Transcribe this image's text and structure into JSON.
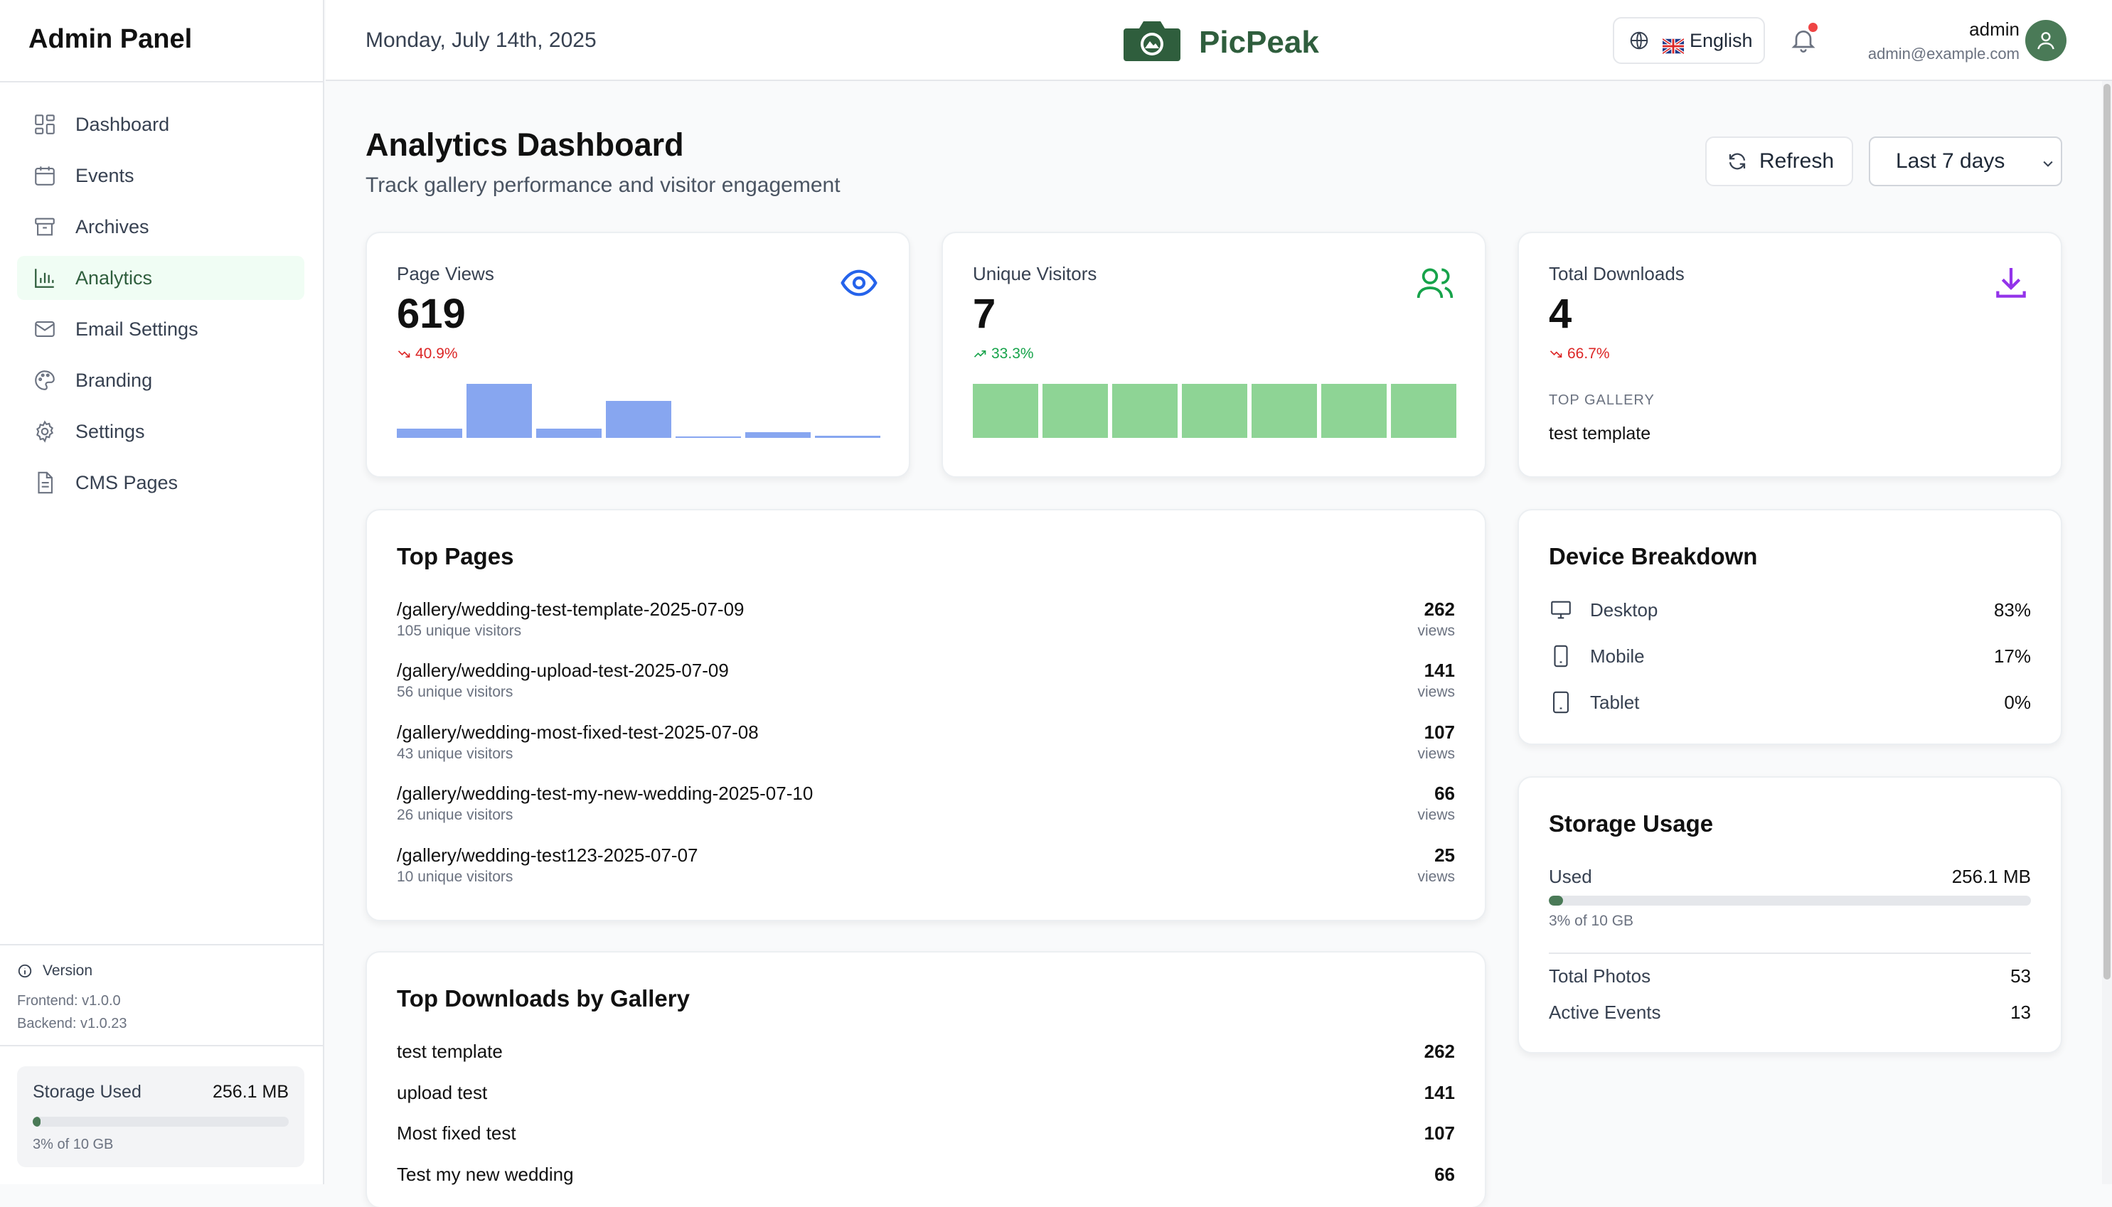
{
  "sidebar": {
    "title": "Admin Panel",
    "items": [
      {
        "label": "Dashboard",
        "icon": "grid-icon"
      },
      {
        "label": "Events",
        "icon": "calendar-icon"
      },
      {
        "label": "Archives",
        "icon": "archive-icon"
      },
      {
        "label": "Analytics",
        "icon": "bar-chart-icon",
        "active": true
      },
      {
        "label": "Email Settings",
        "icon": "mail-icon"
      },
      {
        "label": "Branding",
        "icon": "palette-icon"
      },
      {
        "label": "Settings",
        "icon": "gear-icon"
      },
      {
        "label": "CMS Pages",
        "icon": "document-icon"
      }
    ],
    "version": {
      "label": "Version",
      "frontend": "Frontend: v1.0.0",
      "backend": "Backend: v1.0.23"
    },
    "storage": {
      "label": "Storage Used",
      "value": "256.1 MB",
      "percent": 3,
      "sub": "3% of 10 GB"
    }
  },
  "header": {
    "date": "Monday, July 14th, 2025",
    "brand": "PicPeak",
    "language": "English",
    "user_name": "admin",
    "user_email": "admin@example.com",
    "has_notification": true
  },
  "page": {
    "title": "Analytics Dashboard",
    "subtitle": "Track gallery performance and visitor engagement",
    "refresh_label": "Refresh",
    "range_label": "Last 7 days"
  },
  "stats": {
    "page_views": {
      "label": "Page Views",
      "value": "619",
      "trend": "40.9%",
      "trend_dir": "down",
      "color": "#2563eb",
      "spark_color": "#87a6f0",
      "spark": [
        0.17,
        1.0,
        0.17,
        0.68,
        0.02,
        0.1,
        0.04
      ]
    },
    "unique_visitors": {
      "label": "Unique Visitors",
      "value": "7",
      "trend": "33.3%",
      "trend_dir": "up",
      "color": "#16a34a",
      "spark_color": "#8ed495",
      "spark": [
        1,
        1,
        1,
        1,
        1,
        1,
        1
      ]
    },
    "total_downloads": {
      "label": "Total Downloads",
      "value": "4",
      "trend": "66.7%",
      "trend_dir": "down",
      "color": "#9333ea",
      "top_gallery_label": "TOP GALLERY",
      "top_gallery": "test template"
    }
  },
  "top_pages": {
    "title": "Top Pages",
    "views_label": "views",
    "rows": [
      {
        "path": "/gallery/wedding-test-template-2025-07-09",
        "visitors": "105 unique visitors",
        "views": "262"
      },
      {
        "path": "/gallery/wedding-upload-test-2025-07-09",
        "visitors": "56 unique visitors",
        "views": "141"
      },
      {
        "path": "/gallery/wedding-most-fixed-test-2025-07-08",
        "visitors": "43 unique visitors",
        "views": "107"
      },
      {
        "path": "/gallery/wedding-test-my-new-wedding-2025-07-10",
        "visitors": "26 unique visitors",
        "views": "66"
      },
      {
        "path": "/gallery/wedding-test123-2025-07-07",
        "visitors": "10 unique visitors",
        "views": "25"
      }
    ]
  },
  "top_downloads": {
    "title": "Top Downloads by Gallery",
    "rows": [
      {
        "name": "test template",
        "value": "262"
      },
      {
        "name": "upload test",
        "value": "141"
      },
      {
        "name": "Most fixed test",
        "value": "107"
      },
      {
        "name": "Test my new wedding",
        "value": "66"
      }
    ]
  },
  "devices": {
    "title": "Device Breakdown",
    "rows": [
      {
        "label": "Desktop",
        "pct": "83%",
        "icon": "monitor-icon"
      },
      {
        "label": "Mobile",
        "pct": "17%",
        "icon": "phone-icon"
      },
      {
        "label": "Tablet",
        "pct": "0%",
        "icon": "tablet-icon"
      }
    ]
  },
  "storage": {
    "title": "Storage Usage",
    "used_label": "Used",
    "used_value": "256.1 MB",
    "percent": 3,
    "sub": "3% of 10 GB",
    "photos_label": "Total Photos",
    "photos_value": "53",
    "events_label": "Active Events",
    "events_value": "13"
  },
  "colors": {
    "brand": "#2f5e3d",
    "accent": "#4a7a57",
    "active_bg": "#f0fdf4"
  }
}
